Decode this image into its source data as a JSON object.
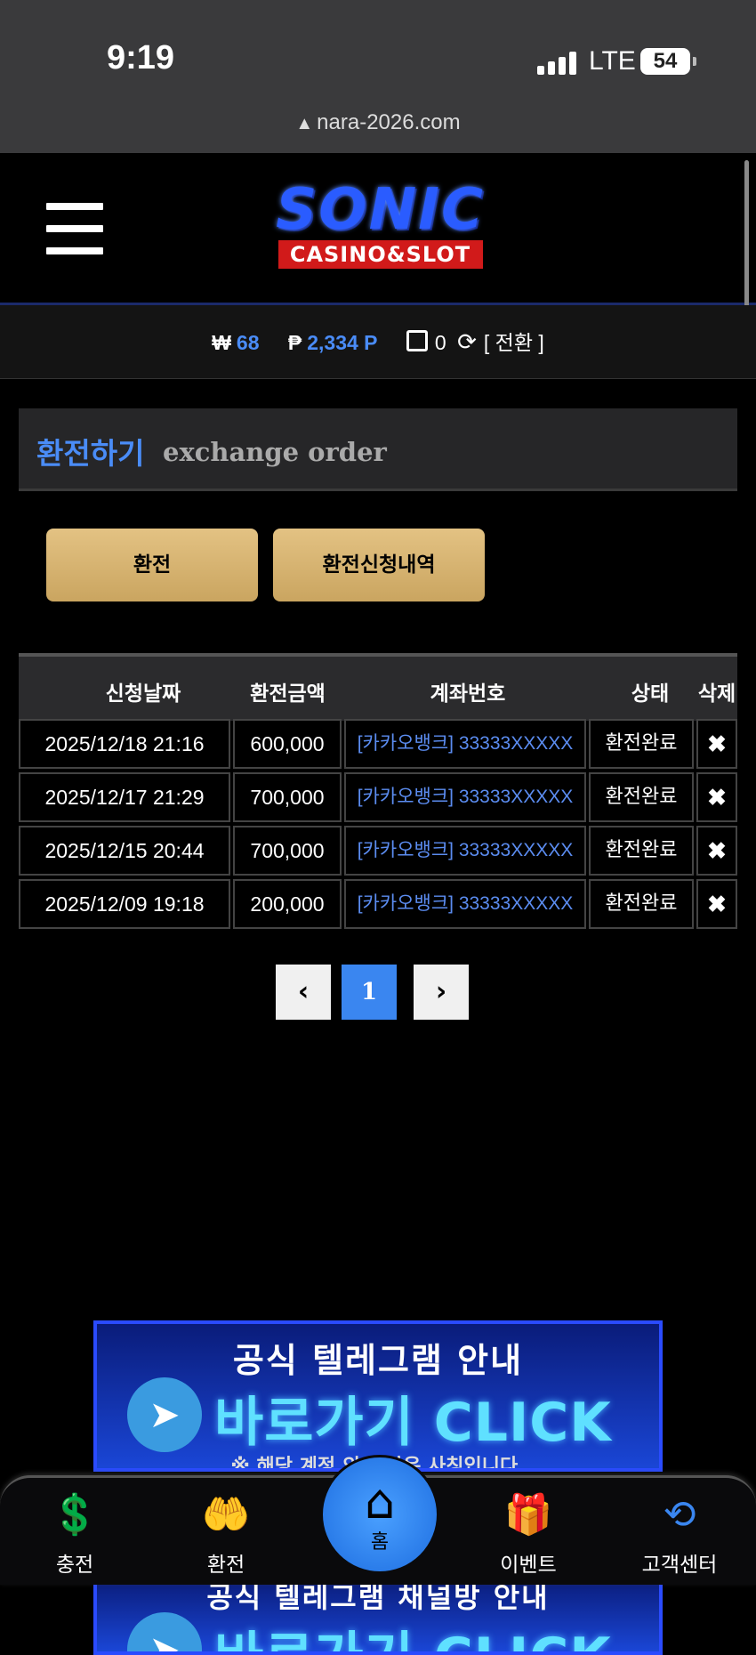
{
  "status": {
    "time": "9:19",
    "network": "LTE",
    "battery": "54"
  },
  "browser": {
    "url": "nara-2026.com"
  },
  "header": {
    "logo_main": "SONIC",
    "logo_sub": "CASINO&SLOT"
  },
  "balance": {
    "won_symbol": "₩",
    "won": "68",
    "point_symbol": "₱",
    "points": "2,334 P",
    "tickets": "0",
    "convert_label": "[ 전환 ]"
  },
  "page": {
    "title_ko": "환전하기",
    "title_en": "exchange order"
  },
  "actions": {
    "exchange_label": "환전",
    "history_label": "환전신청내역"
  },
  "table": {
    "headers": [
      "신청날짜",
      "환전금액",
      "계좌번호",
      "상태",
      "삭제"
    ],
    "rows": [
      {
        "date": "2025/12/18 21:16",
        "amount": "600,000",
        "account": "[카카오뱅크] 33333XXXXX",
        "status": "환전완료"
      },
      {
        "date": "2025/12/17 21:29",
        "amount": "700,000",
        "account": "[카카오뱅크] 33333XXXXX",
        "status": "환전완료"
      },
      {
        "date": "2025/12/15 20:44",
        "amount": "700,000",
        "account": "[카카오뱅크] 33333XXXXX",
        "status": "환전완료"
      },
      {
        "date": "2025/12/09 19:18",
        "amount": "200,000",
        "account": "[카카오뱅크] 33333XXXXX",
        "status": "환전완료"
      }
    ]
  },
  "pagination": {
    "current": "1"
  },
  "banners": {
    "title": "공식 텔레그램 안내",
    "click": "바로가기 CLICK",
    "note": "※ 해당 계정 외 연락은 사칭입니다.",
    "title2": "공식 텔레그램 채널방 안내",
    "click2": "바로가기 CLICK"
  },
  "nav": {
    "charge": "충전",
    "exchange": "환전",
    "home": "홈",
    "event": "이벤트",
    "support": "고객센터"
  },
  "colors": {
    "accent": "#4a8cf7",
    "button": "#dcb877",
    "background": "#000000"
  }
}
